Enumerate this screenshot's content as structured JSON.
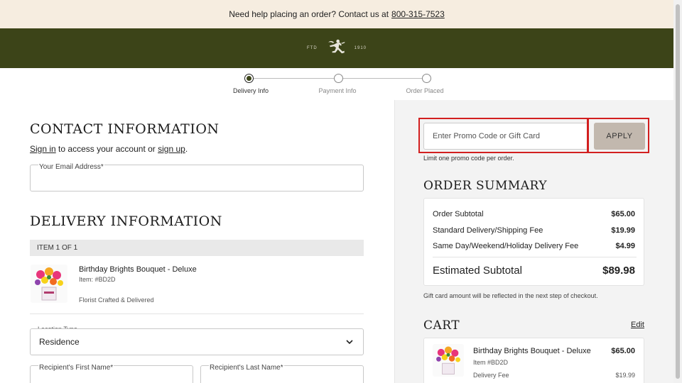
{
  "help_bar": {
    "text": "Need help placing an order? Contact us at",
    "phone": "800-315-7523"
  },
  "brand": {
    "left_text": "FTD",
    "right_text": "1910",
    "logo_icon": "mercury-man-icon"
  },
  "stepper": {
    "steps": [
      {
        "label": "Delivery Info",
        "active": true
      },
      {
        "label": "Payment Info",
        "active": false
      },
      {
        "label": "Order Placed",
        "active": false
      }
    ]
  },
  "contact": {
    "title": "CONTACT INFORMATION",
    "signin_link": "Sign in",
    "middle_text": "to access your account or",
    "signup_link": "sign up",
    "end_text": ".",
    "email_label": "Your Email Address*"
  },
  "delivery": {
    "title": "DELIVERY INFORMATION",
    "item_counter": "ITEM 1 OF 1",
    "product": {
      "name": "Birthday Brights Bouquet - Deluxe",
      "item_no": "Item: #BD2D",
      "fulfillment": "Florist Crafted & Delivered"
    },
    "location_type_label": "Location Type",
    "location_type_value": "Residence",
    "first_name_label": "Recipient's First Name*",
    "last_name_label": "Recipient's Last Name*"
  },
  "promo": {
    "placeholder": "Enter Promo Code or Gift Card",
    "apply_label": "APPLY",
    "hint": "Limit one promo code per order."
  },
  "summary": {
    "title": "ORDER SUMMARY",
    "rows": [
      {
        "label": "Order Subtotal",
        "value": "$65.00"
      },
      {
        "label": "Standard Delivery/Shipping Fee",
        "value": "$19.99"
      },
      {
        "label": "Same Day/Weekend/Holiday Delivery Fee",
        "value": "$4.99"
      }
    ],
    "total_label": "Estimated Subtotal",
    "total_value": "$89.98",
    "gift_card_note": "Gift card amount will be reflected in the next step of checkout."
  },
  "cart": {
    "title": "CART",
    "edit_label": "Edit",
    "item": {
      "name": "Birthday Brights Bouquet - Deluxe",
      "price": "$65.00",
      "item_no": "Item #BD2D",
      "fee_label": "Delivery Fee",
      "fee_value": "$19.99"
    }
  },
  "colors": {
    "brand_green": "#3c4418",
    "help_bar_bg": "#f6ede0",
    "apply_bg": "#c2b8ae",
    "highlight_red": "#d21f1f"
  }
}
